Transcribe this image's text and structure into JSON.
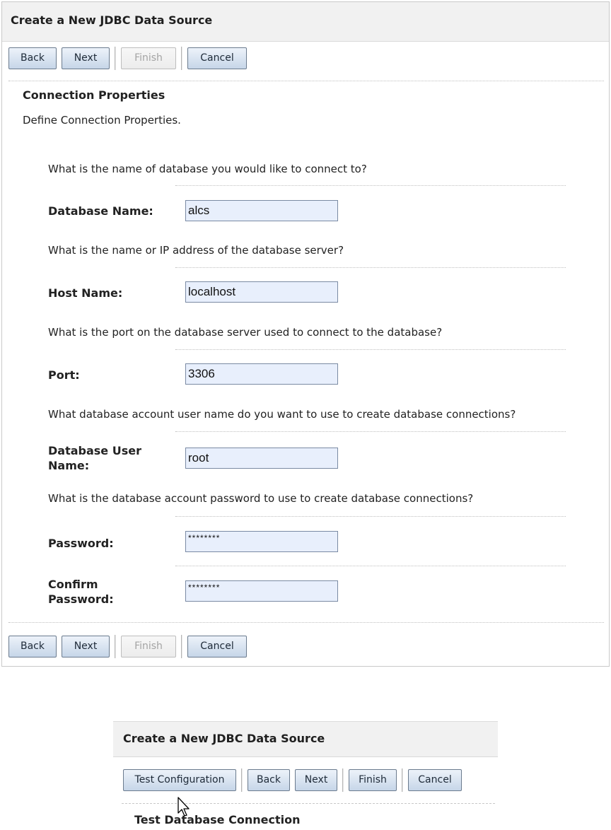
{
  "wizard": {
    "title": "Create a New JDBC Data Source",
    "buttons": {
      "back": "Back",
      "next": "Next",
      "finish": "Finish",
      "cancel": "Cancel"
    },
    "section_title": "Connection Properties",
    "section_desc": "Define Connection Properties.",
    "database_name": {
      "question": "What is the name of database you would like to connect to?",
      "label": "Database Name:",
      "value": "alcs"
    },
    "host_name": {
      "question": "What is the name or IP address of the database server?",
      "label": "Host Name:",
      "value": "localhost"
    },
    "port": {
      "question": "What is the port on the database server used to connect to the database?",
      "label": "Port:",
      "value": "3306"
    },
    "user_name": {
      "question": "What database account user name do you want to use to create database connections?",
      "label_line1": "Database User",
      "label_line2": "Name:",
      "value": "root"
    },
    "password": {
      "question": "What is the database account password to use to create database connections?",
      "label": "Password:",
      "value": "********"
    },
    "confirm_password": {
      "label_line1": "Confirm",
      "label_line2": "Password:",
      "value": "********"
    }
  },
  "test_panel": {
    "title": "Create a New JDBC Data Source",
    "buttons": {
      "test": "Test Configuration",
      "back": "Back",
      "next": "Next",
      "finish": "Finish",
      "cancel": "Cancel"
    },
    "section_title": "Test Database Connection"
  },
  "colors": {
    "button_gradient_top": "#edf3fa",
    "button_gradient_bottom": "#c6d6e8",
    "field_background": "#e8effc",
    "header_background": "#f1f1f1"
  },
  "icons": {
    "cursor": "arrow-cursor-icon"
  }
}
